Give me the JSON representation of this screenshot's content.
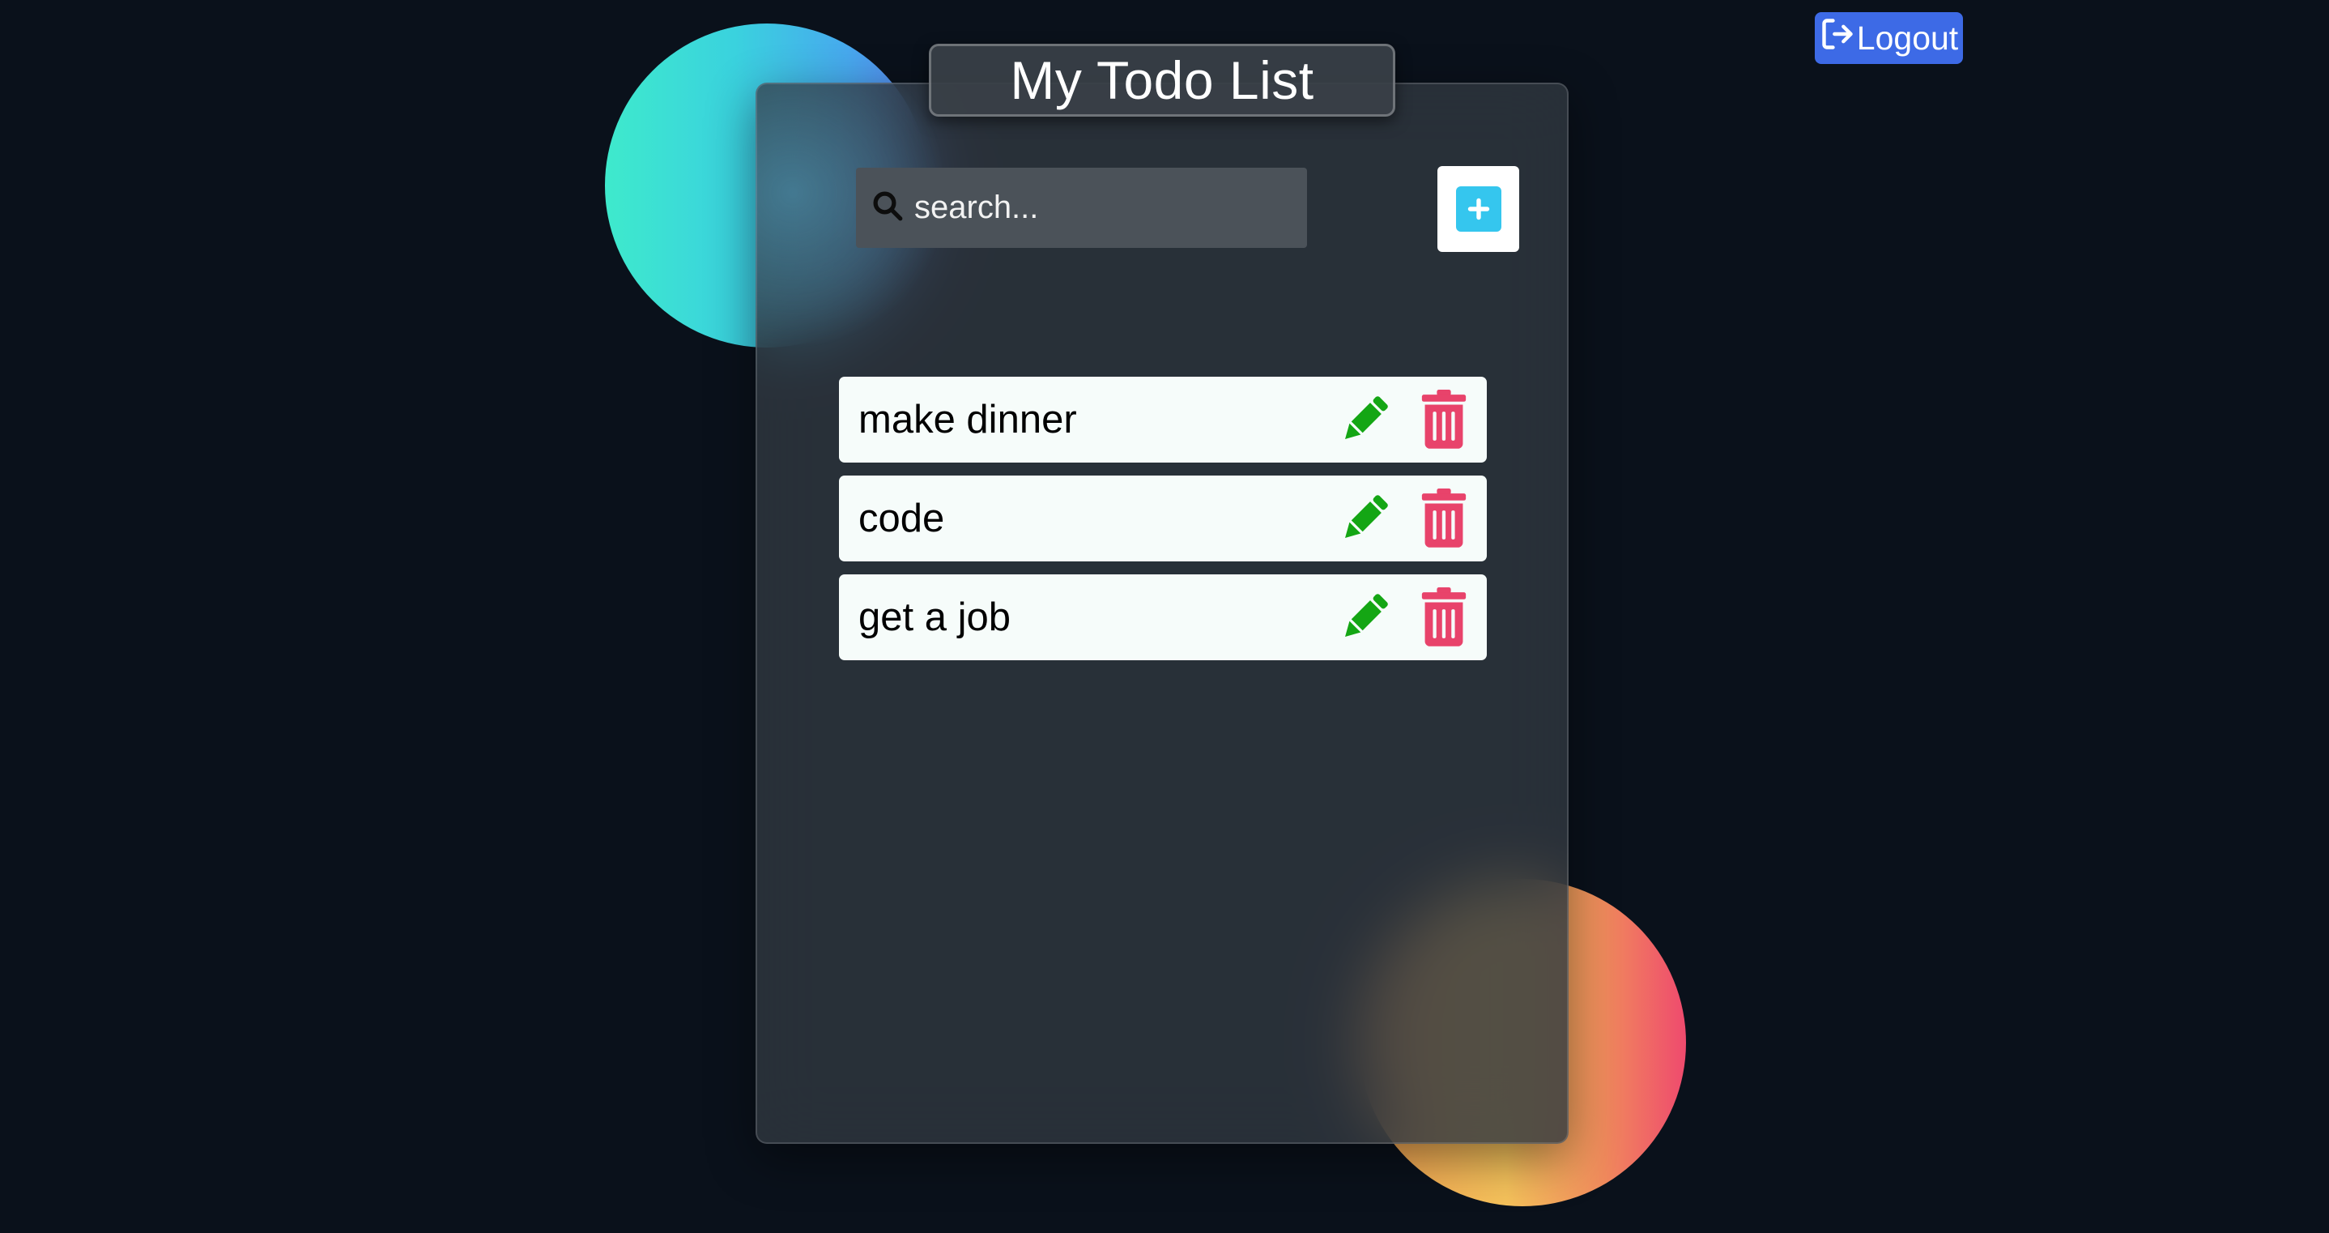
{
  "header": {
    "title": "My Todo List",
    "logout_label": "Logout"
  },
  "search": {
    "placeholder": "search...",
    "value": ""
  },
  "icons": {
    "search": "search-icon",
    "add": "plus-icon",
    "edit": "pencil-icon",
    "delete": "trash-icon",
    "logout": "logout-icon"
  },
  "todos": [
    {
      "text": "make dinner"
    },
    {
      "text": "code"
    },
    {
      "text": "get a job"
    }
  ],
  "colors": {
    "background": "#0a111b",
    "panel": "#2f3740",
    "logout_button": "#3d6ae6",
    "add_accent": "#35c6ee",
    "edit_icon": "#14a614",
    "delete_icon": "#e8436b",
    "item_background": "#f6fcfa"
  }
}
